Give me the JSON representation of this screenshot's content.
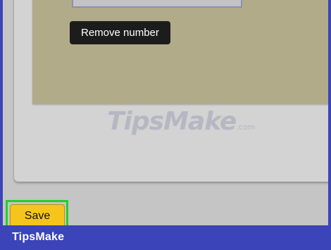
{
  "tooltip": {
    "text": "Remove number"
  },
  "form": {
    "save_label": "Save"
  },
  "watermark": {
    "main": "TipsMake",
    "suffix": ".com"
  },
  "footer": {
    "brand": "TipsMake"
  },
  "colors": {
    "frame": "#3b44b8",
    "screen_bg": "#c5c5c5",
    "card_bg": "#d3d3d3",
    "card_inner": "#b2ab8a",
    "tooltip_bg": "#1c1c1c",
    "save_button": "#f6c51b",
    "highlight": "#1fd129"
  }
}
